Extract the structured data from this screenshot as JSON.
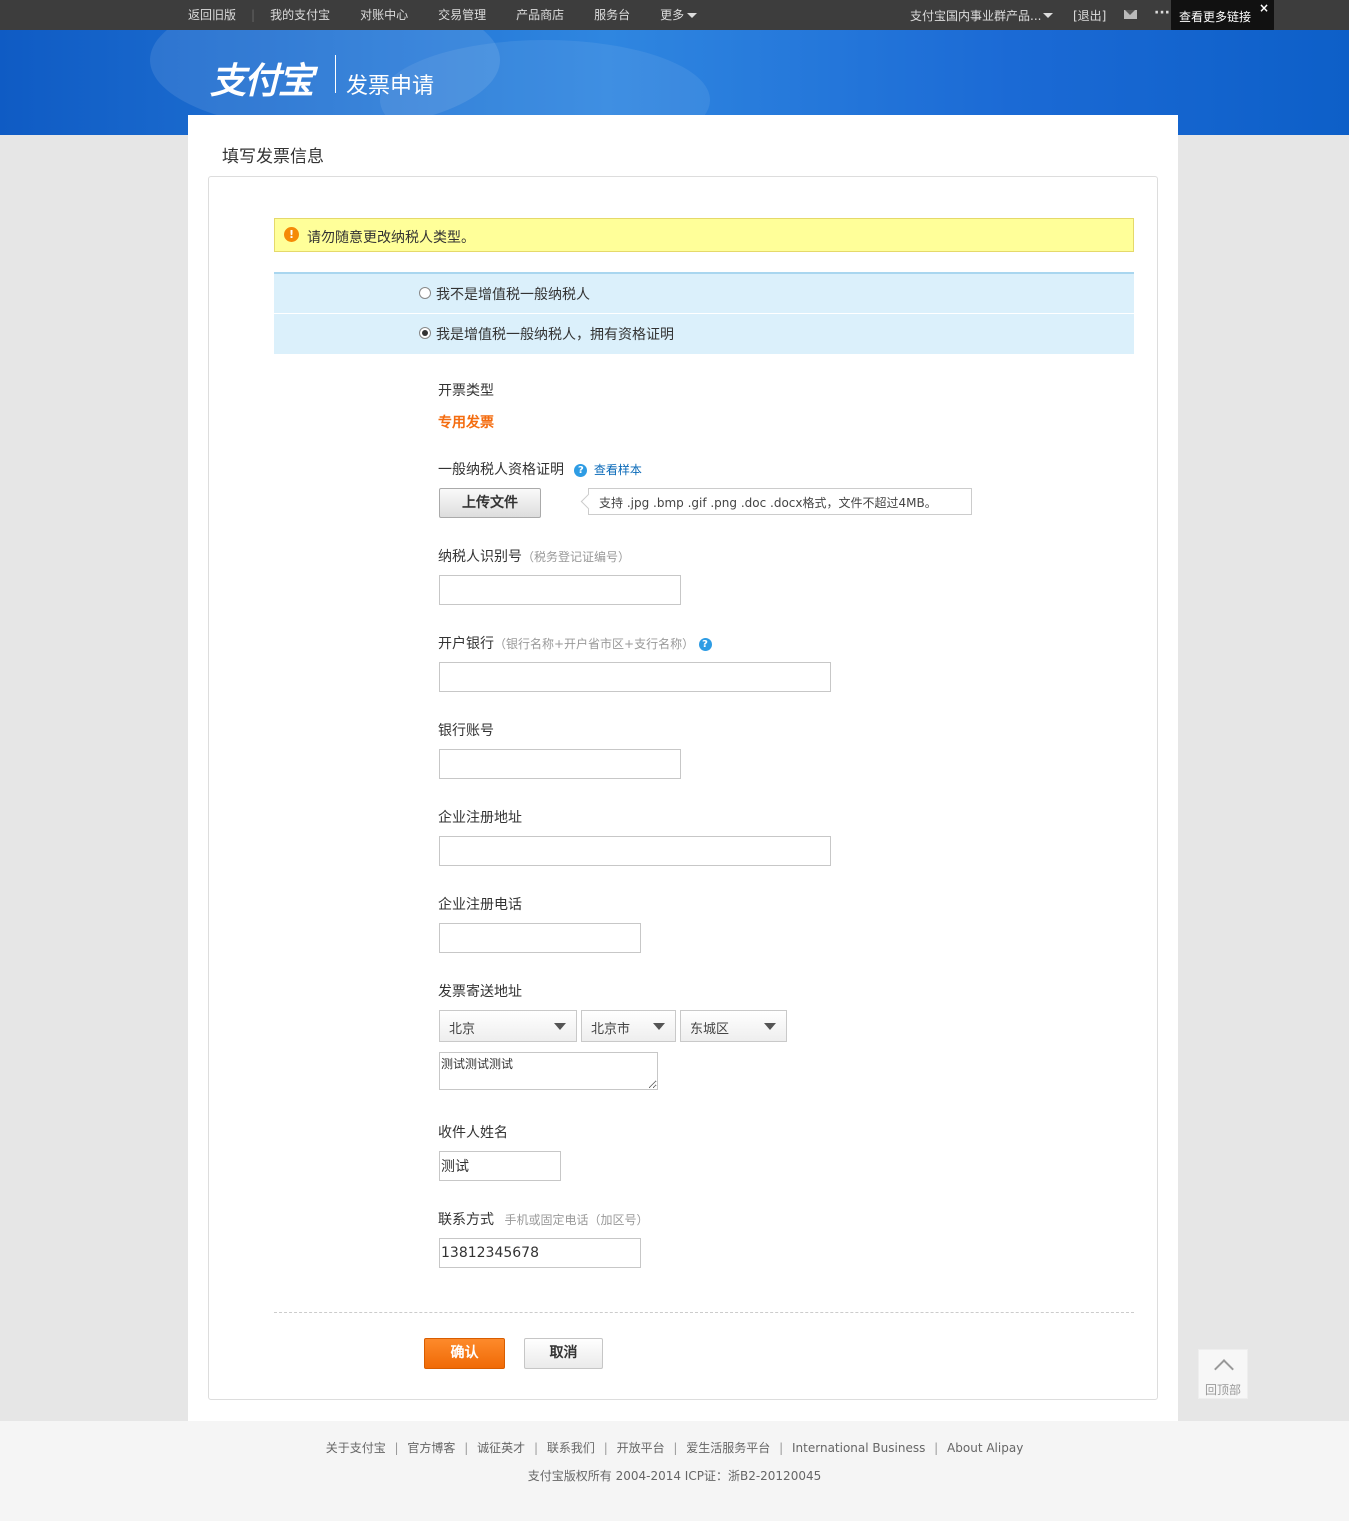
{
  "topbar": {
    "nav": [
      "返回旧版",
      "我的支付宝",
      "对账中心",
      "交易管理",
      "产品商店",
      "服务台",
      "更多"
    ],
    "account": "支付宝国内事业群产品...",
    "logout": "[退出]",
    "mail_icon": "mail-icon",
    "more_icon": "dots-icon",
    "tooltip": "查看更多链接",
    "tooltip_close": "×"
  },
  "header": {
    "logo": "支付宝",
    "title": "发票申请"
  },
  "page": {
    "title": "填写发票信息"
  },
  "warning": {
    "icon": "!",
    "text": "请勿随意更改纳税人类型。"
  },
  "taxpayer": {
    "options": [
      {
        "label": "我不是增值税一般纳税人",
        "checked": false
      },
      {
        "label": "我是增值税一般纳税人，拥有资格证明",
        "checked": true
      }
    ]
  },
  "invoice_type": {
    "label": "开票类型",
    "value": "专用发票"
  },
  "certificate": {
    "label": "一般纳税人资格证明",
    "help_icon": "?",
    "sample_link": "查看样本",
    "upload_button": "上传文件",
    "tip": "支持 .jpg .bmp .gif .png .doc .docx格式，文件不超过4MB。"
  },
  "fields": {
    "taxpayer_id": {
      "label": "纳税人识别号",
      "hint": "（税务登记证编号）",
      "value": ""
    },
    "bank": {
      "label": "开户银行",
      "hint": "（银行名称+开户省市区+支行名称）",
      "value": ""
    },
    "account": {
      "label": "银行账号",
      "value": ""
    },
    "reg_address": {
      "label": "企业注册地址",
      "value": ""
    },
    "reg_phone": {
      "label": "企业注册电话",
      "value": ""
    },
    "mail_address": {
      "label": "发票寄送地址",
      "province": "北京",
      "city": "北京市",
      "district": "东城区",
      "detail": "测试测试测试"
    },
    "recipient": {
      "label": "收件人姓名",
      "value": "测试"
    },
    "contact": {
      "label": "联系方式",
      "hint": "手机或固定电话（加区号）",
      "value": "13812345678"
    }
  },
  "actions": {
    "confirm": "确认",
    "cancel": "取消"
  },
  "back_to_top": {
    "label": "回顶部"
  },
  "footer": {
    "links": [
      "关于支付宝",
      "官方博客",
      "诚征英才",
      "联系我们",
      "开放平台",
      "爱生活服务平台",
      "International Business",
      "About Alipay"
    ],
    "copyright": "支付宝版权所有 2004-2014 ICP证：浙B2-20120045"
  },
  "colors": {
    "accent_orange": "#f46c0f",
    "link_blue": "#0a6ab9",
    "banner_blue": "#1b6ad5",
    "warning_bg": "#ffff99"
  }
}
